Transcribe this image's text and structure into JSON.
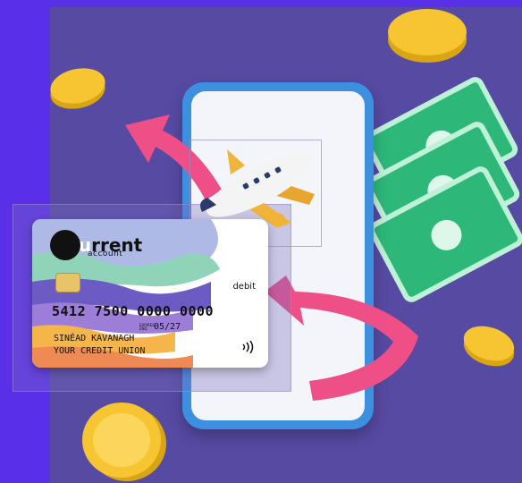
{
  "card": {
    "brand_word": "current",
    "brand_sub": "account",
    "type": "debit",
    "number": "5412 7500 0000 0000",
    "expiry_label": "EXPIRES END",
    "expiry": "05/27",
    "holder_name": "SINÉAD KAVANAGH",
    "issuer": "YOUR CREDIT UNION"
  },
  "colors": {
    "outer_bg": "#5a2fe8",
    "panel_bg": "#564aa3",
    "phone_frame": "#3d8fe0",
    "arrow_pink": "#ee4f86",
    "coin_gold": "#f7c531",
    "bill_green": "#2db87a"
  },
  "icons": [
    "airplane-icon",
    "contactless-icon",
    "chip-icon",
    "coin-icon",
    "banknote-icon",
    "arrow-icon",
    "smartphone-icon"
  ]
}
